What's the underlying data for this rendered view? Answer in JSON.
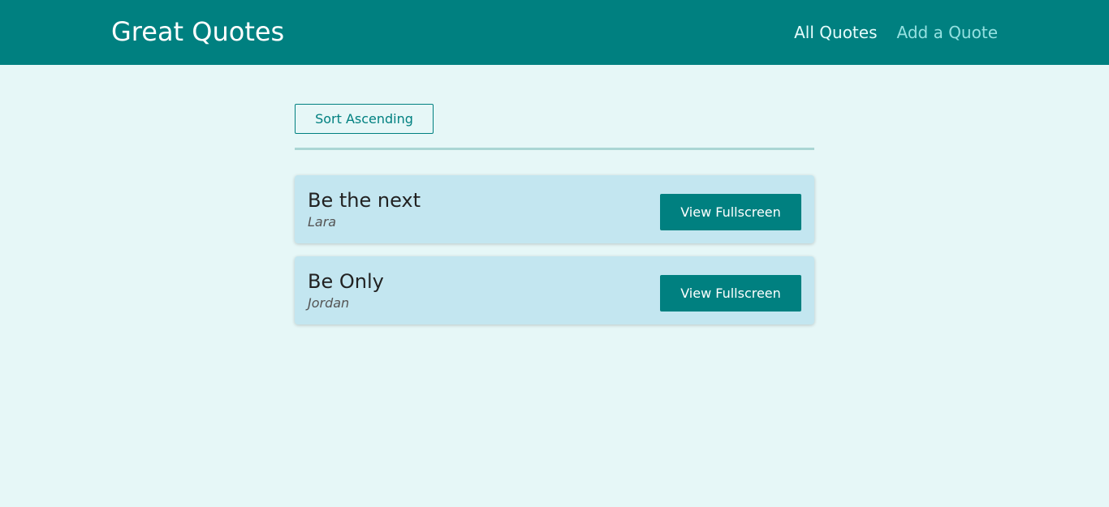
{
  "header": {
    "title": "Great Quotes",
    "nav": [
      {
        "label": "All Quotes",
        "active": true
      },
      {
        "label": "Add a Quote",
        "active": false
      }
    ]
  },
  "main": {
    "sort_label": "Sort Ascending",
    "quotes": [
      {
        "text": "Be the next",
        "author": "Lara",
        "button_label": "View Fullscreen"
      },
      {
        "text": "Be Only",
        "author": "Jordan",
        "button_label": "View Fullscreen"
      }
    ]
  },
  "colors": {
    "header_bg": "#008080",
    "page_bg": "#e6f7f7",
    "card_bg": "#c3e6f0",
    "accent": "#008080",
    "nav_active": "#e6fcfc",
    "nav_inactive": "#95e1e1"
  }
}
